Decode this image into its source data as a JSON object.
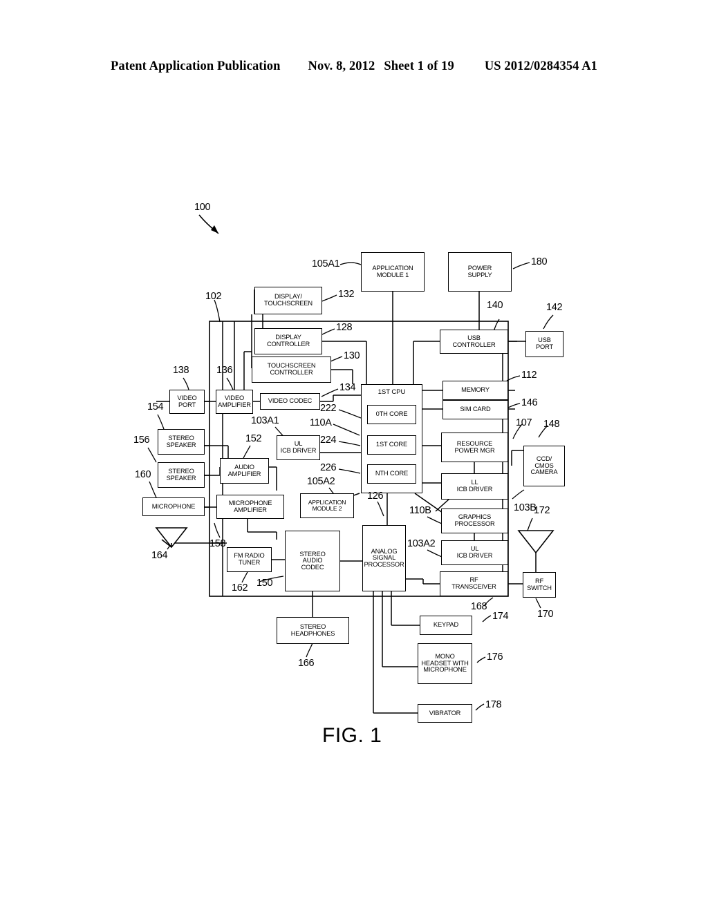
{
  "header": {
    "publication": "Patent Application Publication",
    "date": "Nov. 8, 2012",
    "sheet": "Sheet 1 of 19",
    "patent_number": "US 2012/0284354 A1"
  },
  "figure": {
    "caption": "FIG. 1",
    "system_ref": "100"
  },
  "blocks": [
    {
      "id": "application_module_1",
      "label": [
        "APPLICATION",
        "MODULE 1"
      ],
      "ref": "105A1"
    },
    {
      "id": "power_supply",
      "label": [
        "POWER",
        "SUPPLY"
      ],
      "ref": "180"
    },
    {
      "id": "display_touchscreen",
      "label": [
        "DISPLAY/",
        "TOUCHSCREEN"
      ],
      "ref": "132"
    },
    {
      "id": "display_controller",
      "label": [
        "DISPLAY",
        "CONTROLLER"
      ],
      "ref": "128"
    },
    {
      "id": "touchscreen_controller",
      "label": [
        "TOUCHSCREEN",
        "CONTROLLER"
      ],
      "ref": "130"
    },
    {
      "id": "usb_controller",
      "label": [
        "USB",
        "CONTROLLER"
      ],
      "ref": "140"
    },
    {
      "id": "usb_port",
      "label": [
        "USB",
        "PORT"
      ],
      "ref": "142"
    },
    {
      "id": "memory",
      "label": [
        "MEMORY"
      ],
      "ref": "112"
    },
    {
      "id": "sim_card",
      "label": [
        "SIM CARD"
      ],
      "ref": "146"
    },
    {
      "id": "video_port",
      "label": [
        "VIDEO",
        "PORT"
      ],
      "ref": "138"
    },
    {
      "id": "video_amplifier",
      "label": [
        "VIDEO",
        "AMPLIFIER"
      ],
      "ref": "136"
    },
    {
      "id": "video_codec",
      "label": [
        "VIDEO CODEC"
      ],
      "ref": "134"
    },
    {
      "id": "first_cpu",
      "label": [
        "1ST CPU"
      ],
      "ref": "110A"
    },
    {
      "id": "zeroth_core",
      "label": [
        "0TH CORE"
      ],
      "ref": "222"
    },
    {
      "id": "first_core",
      "label": [
        "1ST CORE"
      ],
      "ref": "224"
    },
    {
      "id": "nth_core",
      "label": [
        "NTH CORE"
      ],
      "ref": "226"
    },
    {
      "id": "ul_icb_driver_a1",
      "label": [
        "UL",
        "ICB DRIVER"
      ],
      "ref": "103A1"
    },
    {
      "id": "resource_power_mgr",
      "label": [
        "RESOURCE",
        "POWER MGR"
      ],
      "ref": "107"
    },
    {
      "id": "ll_icb_driver",
      "label": [
        "LL",
        "ICB DRIVER"
      ],
      "ref": "103B"
    },
    {
      "id": "ccd_cmos_camera",
      "label": [
        "CCD/",
        "CMOS",
        "CAMERA"
      ],
      "ref": "148"
    },
    {
      "id": "stereo_speaker_1",
      "label": [
        "STEREO",
        "SPEAKER"
      ],
      "ref": "154"
    },
    {
      "id": "stereo_speaker_2",
      "label": [
        "STEREO",
        "SPEAKER"
      ],
      "ref": "156"
    },
    {
      "id": "microphone",
      "label": [
        "MICROPHONE"
      ],
      "ref": "160"
    },
    {
      "id": "audio_amplifier",
      "label": [
        "AUDIO",
        "AMPLIFIER"
      ],
      "ref": "152"
    },
    {
      "id": "microphone_amplifier",
      "label": [
        "MICROPHONE",
        "AMPLIFIER"
      ],
      "ref": "158"
    },
    {
      "id": "application_module_2",
      "label": [
        "APPLICATION",
        "MODULE 2"
      ],
      "ref": "105A2"
    },
    {
      "id": "fm_radio_tuner",
      "label": [
        "FM RADIO",
        "TUNER"
      ],
      "ref": "162"
    },
    {
      "id": "stereo_audio_codec",
      "label": [
        "STEREO",
        "AUDIO",
        "CODEC"
      ],
      "ref": "150"
    },
    {
      "id": "analog_signal_processor",
      "label": [
        "ANALOG",
        "SIGNAL",
        "PROCESSOR"
      ],
      "ref": "126"
    },
    {
      "id": "graphics_processor",
      "label": [
        "GRAPHICS",
        "PROCESSOR"
      ],
      "ref": "110B"
    },
    {
      "id": "ul_icb_driver_a2",
      "label": [
        "UL",
        "ICB DRIVER"
      ],
      "ref": "103A2"
    },
    {
      "id": "rf_transceiver",
      "label": [
        "RF",
        "TRANSCEIVER"
      ],
      "ref": "168"
    },
    {
      "id": "rf_switch",
      "label": [
        "RF",
        "SWITCH"
      ],
      "ref": "170"
    },
    {
      "id": "stereo_headphones",
      "label": [
        "STEREO",
        "HEADPHONES"
      ],
      "ref": "166"
    },
    {
      "id": "keypad",
      "label": [
        "KEYPAD"
      ],
      "ref": "174"
    },
    {
      "id": "mono_headset",
      "label": [
        "MONO",
        "HEADSET WITH",
        "MICROPHONE"
      ],
      "ref": "176"
    },
    {
      "id": "vibrator",
      "label": [
        "VIBRATOR"
      ],
      "ref": "178"
    }
  ],
  "antennas": [
    {
      "id": "fm_antenna",
      "ref": "164"
    },
    {
      "id": "rf_antenna",
      "ref": "172"
    }
  ],
  "chassis": {
    "ref": "102"
  },
  "refs": {
    "r100": "100",
    "r102": "102",
    "r103A1": "103A1",
    "r103A2": "103A2",
    "r103B": "103B",
    "r105A1": "105A1",
    "r105A2": "105A2",
    "r107": "107",
    "r110A": "110A",
    "r110B": "110B",
    "r112": "112",
    "r126": "126",
    "r128": "128",
    "r130": "130",
    "r132": "132",
    "r134": "134",
    "r136": "136",
    "r138": "138",
    "r140": "140",
    "r142": "142",
    "r146": "146",
    "r148": "148",
    "r150": "150",
    "r152": "152",
    "r154": "154",
    "r156": "156",
    "r158": "158",
    "r160": "160",
    "r162": "162",
    "r164": "164",
    "r166": "166",
    "r168": "168",
    "r170": "170",
    "r172": "172",
    "r174": "174",
    "r176": "176",
    "r178": "178",
    "r180": "180",
    "r222": "222",
    "r224": "224",
    "r226": "226"
  },
  "labels": {
    "application_module_1_l1": "APPLICATION",
    "application_module_1_l2": "MODULE 1",
    "power_supply_l1": "POWER",
    "power_supply_l2": "SUPPLY",
    "display_touchscreen_l1": "DISPLAY/",
    "display_touchscreen_l2": "TOUCHSCREEN",
    "display_controller_l1": "DISPLAY",
    "display_controller_l2": "CONTROLLER",
    "touchscreen_controller_l1": "TOUCHSCREEN",
    "touchscreen_controller_l2": "CONTROLLER",
    "usb_controller_l1": "USB",
    "usb_controller_l2": "CONTROLLER",
    "usb_port_l1": "USB",
    "usb_port_l2": "PORT",
    "memory_l1": "MEMORY",
    "sim_card_l1": "SIM CARD",
    "video_port_l1": "VIDEO",
    "video_port_l2": "PORT",
    "video_amplifier_l1": "VIDEO",
    "video_amplifier_l2": "AMPLIFIER",
    "video_codec_l1": "VIDEO CODEC",
    "first_cpu_l1": "1ST CPU",
    "zeroth_core_l1": "0TH CORE",
    "first_core_l1": "1ST CORE",
    "nth_core_l1": "NTH CORE",
    "ul_icb_driver_a1_l1": "UL",
    "ul_icb_driver_a1_l2": "ICB DRIVER",
    "resource_power_mgr_l1": "RESOURCE",
    "resource_power_mgr_l2": "POWER MGR",
    "ll_icb_driver_l1": "LL",
    "ll_icb_driver_l2": "ICB DRIVER",
    "ccd_cmos_camera_l1": "CCD/",
    "ccd_cmos_camera_l2": "CMOS",
    "ccd_cmos_camera_l3": "CAMERA",
    "stereo_speaker_1_l1": "STEREO",
    "stereo_speaker_1_l2": "SPEAKER",
    "stereo_speaker_2_l1": "STEREO",
    "stereo_speaker_2_l2": "SPEAKER",
    "microphone_l1": "MICROPHONE",
    "audio_amplifier_l1": "AUDIO",
    "audio_amplifier_l2": "AMPLIFIER",
    "microphone_amplifier_l1": "MICROPHONE",
    "microphone_amplifier_l2": "AMPLIFIER",
    "application_module_2_l1": "APPLICATION",
    "application_module_2_l2": "MODULE 2",
    "fm_radio_tuner_l1": "FM RADIO",
    "fm_radio_tuner_l2": "TUNER",
    "stereo_audio_codec_l1": "STEREO",
    "stereo_audio_codec_l2": "AUDIO",
    "stereo_audio_codec_l3": "CODEC",
    "analog_signal_processor_l1": "ANALOG",
    "analog_signal_processor_l2": "SIGNAL",
    "analog_signal_processor_l3": "PROCESSOR",
    "graphics_processor_l1": "GRAPHICS",
    "graphics_processor_l2": "PROCESSOR",
    "ul_icb_driver_a2_l1": "UL",
    "ul_icb_driver_a2_l2": "ICB DRIVER",
    "rf_transceiver_l1": "RF",
    "rf_transceiver_l2": "TRANSCEIVER",
    "rf_switch_l1": "RF",
    "rf_switch_l2": "SWITCH",
    "stereo_headphones_l1": "STEREO",
    "stereo_headphones_l2": "HEADPHONES",
    "keypad_l1": "KEYPAD",
    "mono_headset_l1": "MONO",
    "mono_headset_l2": "HEADSET WITH",
    "mono_headset_l3": "MICROPHONE",
    "vibrator_l1": "VIBRATOR"
  }
}
